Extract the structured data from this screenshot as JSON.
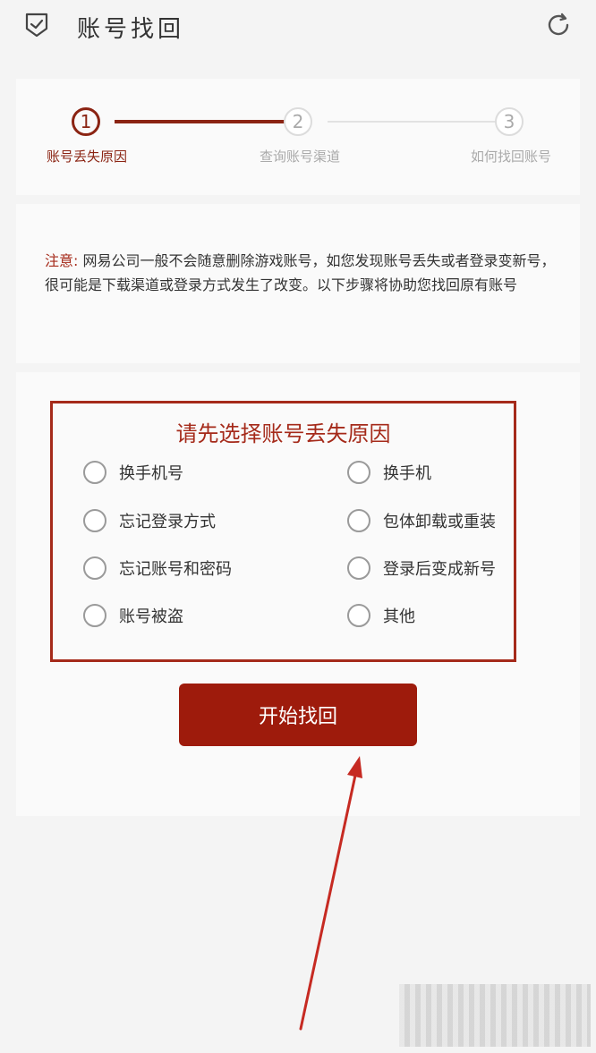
{
  "header": {
    "title": "账号找回",
    "shield_icon": "shield-check-icon",
    "refresh_icon": "refresh-icon"
  },
  "steps": [
    {
      "number": "1",
      "label": "账号丢失原因",
      "active": true
    },
    {
      "number": "2",
      "label": "查询账号渠道",
      "active": false
    },
    {
      "number": "3",
      "label": "如何找回账号",
      "active": false
    }
  ],
  "note": {
    "label": "注意:",
    "text": "网易公司一般不会随意删除游戏账号，如您发现账号丢失或者登录变新号，很可能是下载渠道或登录方式发生了改变。以下步骤将协助您找回原有账号"
  },
  "reasons": {
    "title": "请先选择账号丢失原因",
    "options": [
      "换手机号",
      "换手机",
      "忘记登录方式",
      "包体卸载或重装",
      "忘记账号和密码",
      "登录后变成新号",
      "账号被盗",
      "其他"
    ]
  },
  "start_button": "开始找回",
  "colors": {
    "accent": "#8b2413",
    "button": "#9e1b0c",
    "background": "#f4f4f4"
  }
}
